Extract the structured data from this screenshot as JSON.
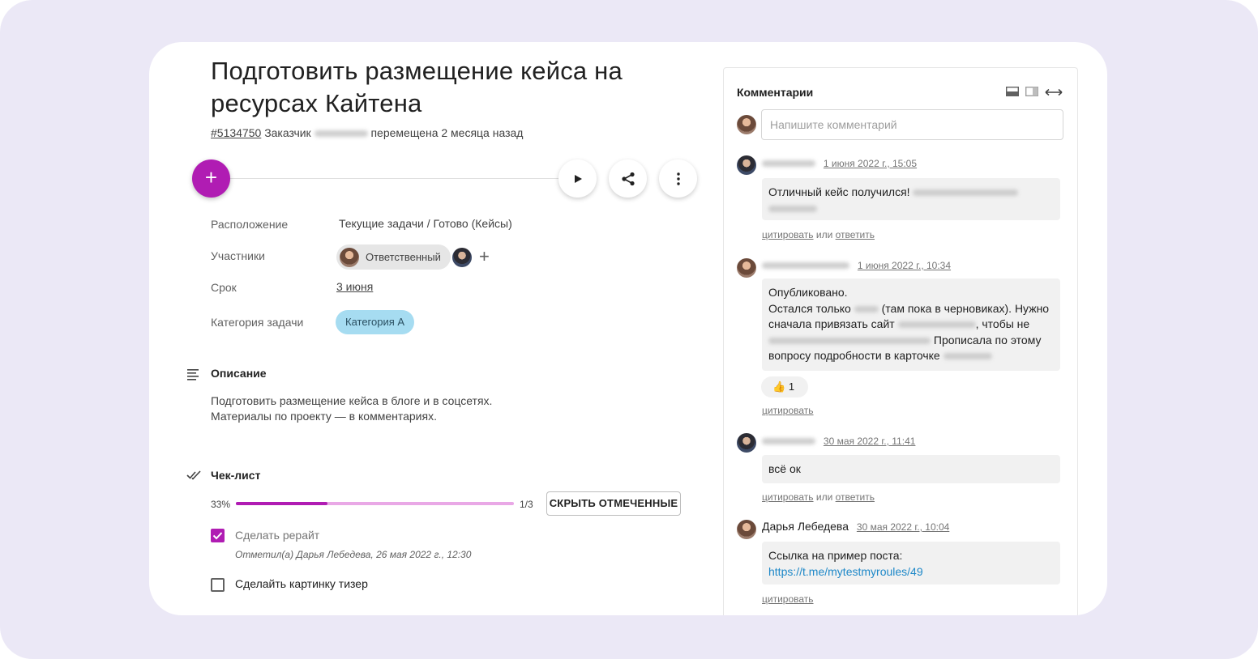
{
  "task": {
    "title": "Подготовить размещение кейса на ресурсах Кайтена",
    "id_link": "#5134750",
    "customer_label": "Заказчик",
    "moved_text": "перемещена 2 месяца назад"
  },
  "actions": {
    "add_label": "+",
    "play_icon": "play-icon",
    "share_icon": "share-icon",
    "more_icon": "more-vertical-icon"
  },
  "props": {
    "location_label": "Расположение",
    "location_value": "Текущие задачи / Готово (Кейсы)",
    "members_label": "Участники",
    "responsible_chip": "Ответственный",
    "add_member": "+",
    "due_label": "Срок",
    "due_value": "3 июня",
    "category_label": "Категория задачи",
    "category_value": "Категория А"
  },
  "description": {
    "heading": "Описание",
    "line1": "Подготовить размещение кейса в блоге и в соцсетях.",
    "line2": "Материалы по проекту — в комментариях."
  },
  "checklist": {
    "heading": "Чек-лист",
    "percent_text": "33%",
    "progress": 0.33,
    "count_text": "1/3",
    "hide_button": "СКРЫТЬ ОТМЕЧЕННЫЕ",
    "items": [
      {
        "label": "Сделать рерайт",
        "checked": true,
        "note": "Отметил(а) Дарья Лебедева, 26 мая 2022 г., 12:30"
      },
      {
        "label": "Сделайть картинку тизер",
        "checked": false
      }
    ]
  },
  "comments": {
    "title": "Комментарии",
    "placeholder": "Напишите комментарий",
    "quote": "цитировать",
    "or": "или",
    "reply": "ответить",
    "items": [
      {
        "date": "1 июня 2022 г., 15:05",
        "text": "Отличный кейс получился!"
      },
      {
        "date": "1 июня 2022 г., 10:34",
        "line1": "Опубликовано.",
        "line2a": "Остался только",
        "line2b": "(там пока в черновиках). Нужно",
        "line3a": "сначала привязать сайт",
        "line3b": ", чтобы не",
        "line4": "Прописала по этому",
        "line5": "вопросу подробности в карточке",
        "reaction_count": "1"
      },
      {
        "date": "30 мая 2022 г., 11:41",
        "text": "всё ок"
      },
      {
        "author": "Дарья Лебедева",
        "date": "30 мая 2022 г., 10:04",
        "text": "Ссылка на пример поста:",
        "link": "https://t.me/mytestmyroules/49"
      }
    ]
  }
}
